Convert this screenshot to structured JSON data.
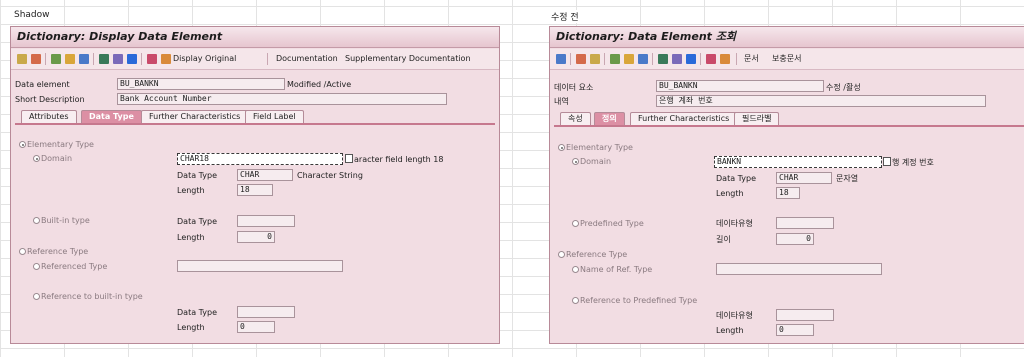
{
  "captions": {
    "left": "Shadow",
    "right": "수정 전"
  },
  "colors": {
    "panel_bg": "#f2dde3",
    "title_bg": "#e6c5cf",
    "active_tab": "#dc8fa4",
    "field_bg": "#f6ecef"
  },
  "left": {
    "title": "Dictionary: Display Data Element",
    "toolbar": {
      "display_original": "Display Original",
      "documentation": "Documentation",
      "supplementary": "Supplementary Documentation"
    },
    "header": {
      "data_element_label": "Data element",
      "data_element_value": "BU_BANKN",
      "status": "Modified /Active",
      "short_desc_label": "Short Description",
      "short_desc_value": "Bank Account Number"
    },
    "tabs": [
      "Attributes",
      "Data Type",
      "Further Characteristics",
      "Field Label"
    ],
    "content": {
      "elementary_type": "Elementary Type",
      "domain": "Domain",
      "domain_value": "CHAR18",
      "domain_desc": "aracter field length 18",
      "data_type_label": "Data Type",
      "data_type_value": "CHAR",
      "data_type_desc": "Character String",
      "length_label": "Length",
      "length_value": "18",
      "builtin": "Built-in type",
      "bi_data_type_label": "Data Type",
      "bi_length_label": "Length",
      "bi_length_value": "0",
      "reference_type": "Reference Type",
      "referenced_type": "Referenced Type",
      "ref_builtin": "Reference to built-in type",
      "rb_data_type_label": "Data Type",
      "rb_length_label": "Length",
      "rb_length_value": "0"
    }
  },
  "right": {
    "title": "Dictionary: Data Element 조회",
    "toolbar": {
      "documentation": "문서",
      "supplementary": "보충문서"
    },
    "header": {
      "data_element_label": "데이터 요소",
      "data_element_value": "BU_BANKN",
      "status": "수정 /활성",
      "short_desc_label": "내역",
      "short_desc_value": "은행 계좌 번호"
    },
    "tabs": [
      "속성",
      "정의",
      "Further Characteristics",
      "필드라벨"
    ],
    "content": {
      "elementary_type": "Elementary Type",
      "domain": "Domain",
      "domain_value": "BANKN",
      "domain_desc": "행 계정 번호",
      "data_type_label": "Data Type",
      "data_type_value": "CHAR",
      "data_type_desc": "문자열",
      "length_label": "Length",
      "length_value": "18",
      "predefined": "Predefined Type",
      "pd_data_type_label": "데이타유형",
      "pd_length_label": "길이",
      "pd_length_value": "0",
      "reference_type": "Reference Type",
      "name_ref_type": "Name of Ref. Type",
      "ref_predefined": "Reference to Predefined Type",
      "rp_data_type_label": "데이타유형",
      "rp_length_label": "Length",
      "rp_length_value": "0"
    }
  }
}
